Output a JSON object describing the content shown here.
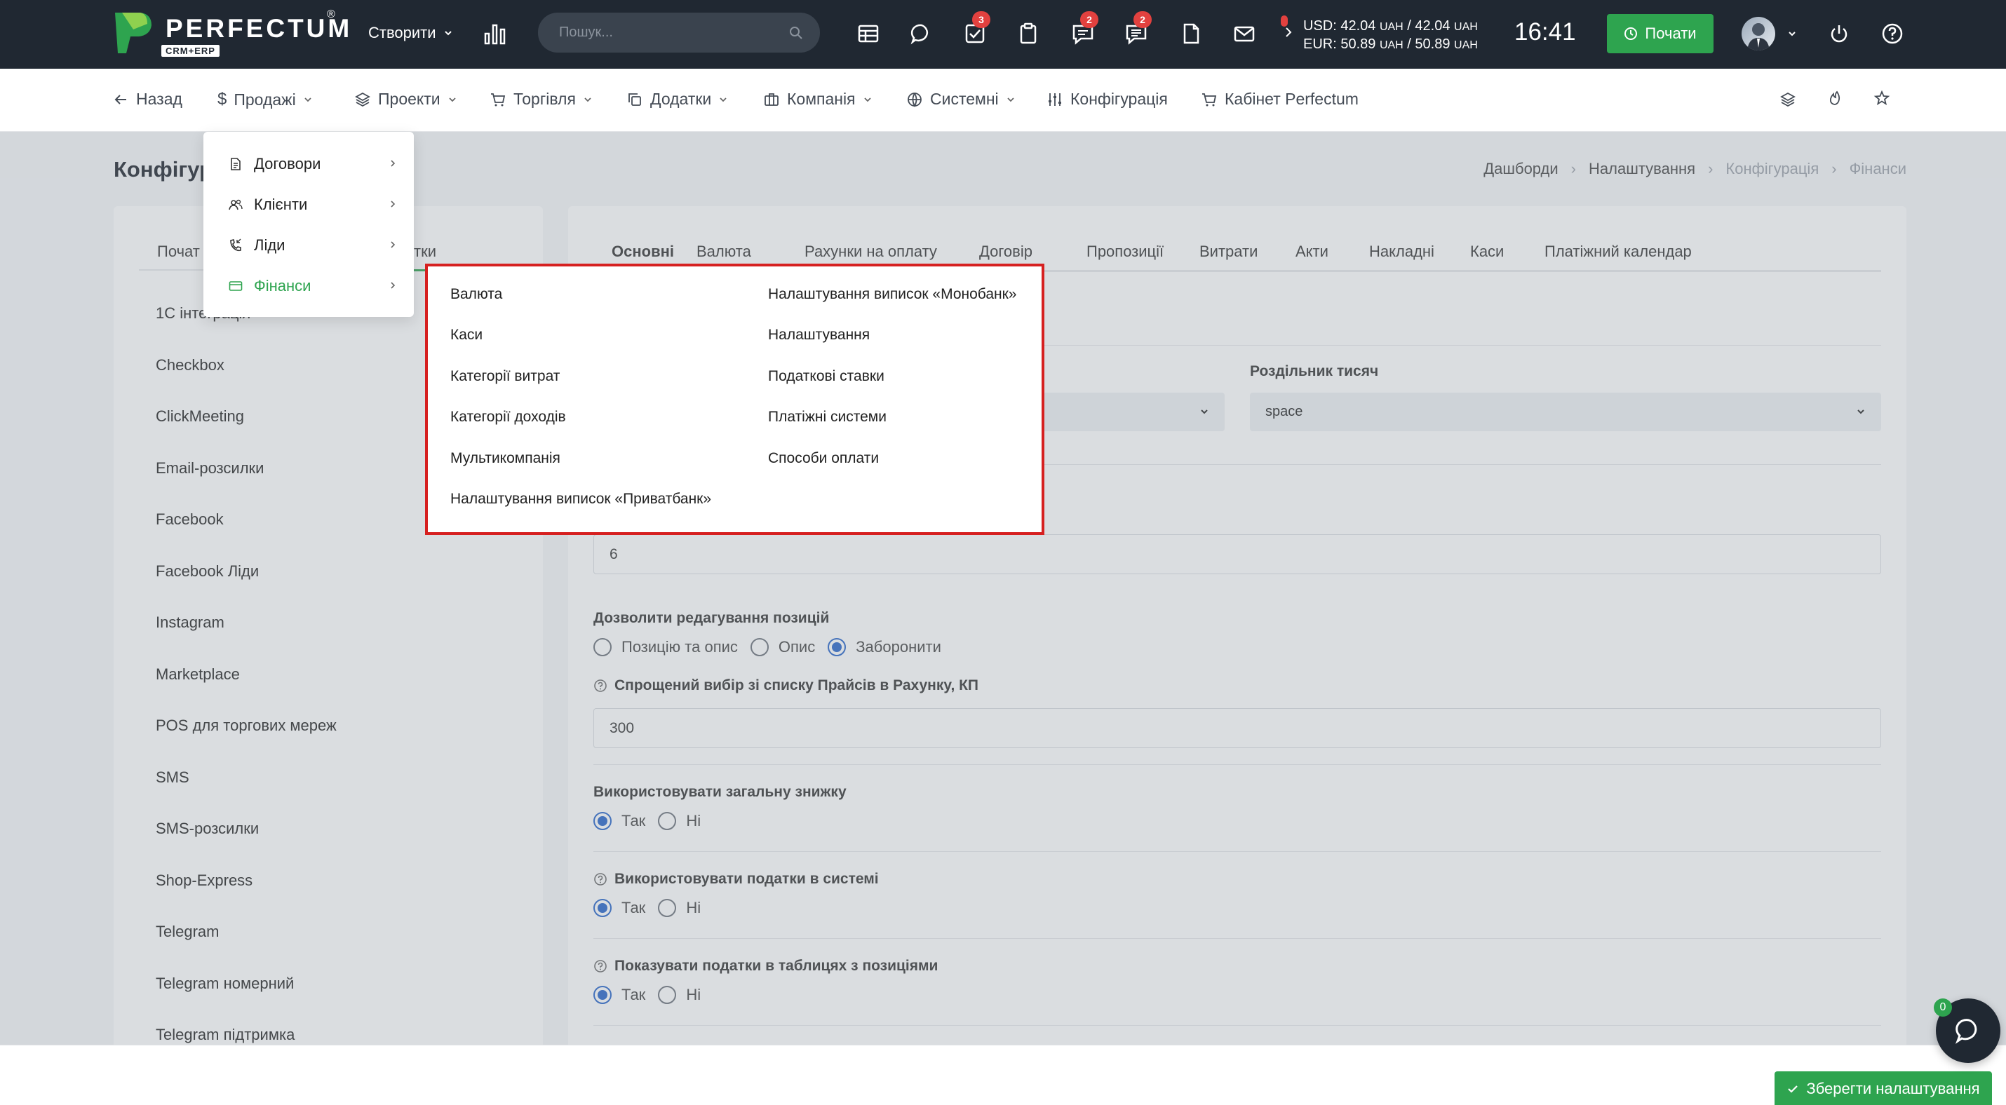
{
  "topbar": {
    "logo_text": "PERFECTUM",
    "logo_sub": "CRM+ERP",
    "logo_reg": "®",
    "create_label": "Створити",
    "search_placeholder": "Пошук...",
    "badges": {
      "tasks": "3",
      "chat": "2",
      "messages": "2"
    },
    "rates": {
      "usd_prefix": "USD: 42.04 ",
      "usd_unit1": "UAH",
      "usd_mid": " / 42.04 ",
      "usd_unit2": "UAH",
      "eur_prefix": "EUR: 50.89 ",
      "eur_unit1": "UAH",
      "eur_mid": " / 50.89 ",
      "eur_unit2": "UAH"
    },
    "clock": "16:41",
    "start_label": "Почати"
  },
  "subnav": {
    "back": "Назад",
    "sales": "Продажі",
    "projects": "Проекти",
    "trade": "Торгівля",
    "addons": "Додатки",
    "company": "Компанія",
    "system": "Системні",
    "config": "Конфігурація",
    "cabinet": "Кабінет Perfectum"
  },
  "page": {
    "title": "Конфігурація",
    "breadcrumb": [
      "Дашборди",
      "Налаштування",
      "Конфігурація",
      "Фінанси"
    ]
  },
  "left": {
    "tabs": [
      "Почат",
      "тки"
    ],
    "items": [
      "1С інтеграція",
      "Checkbox",
      "ClickMeeting",
      "Email-розсилки",
      "Facebook",
      "Facebook Ліди",
      "Instagram",
      "Marketplace",
      "POS для торгових мереж",
      "SMS",
      "SMS-розсилки",
      "Shop-Express",
      "Telegram",
      "Telegram номерний",
      "Telegram підтримка"
    ]
  },
  "right": {
    "tabs": [
      "Основні",
      "Валюта",
      "Рахунки на оплату",
      "Договір",
      "Пропозиції",
      "Витрати",
      "Акти",
      "Накладні",
      "Каси",
      "Платіжний календар"
    ],
    "thousand_sep_label": "Роздільник тисяч",
    "thousand_sep_value": "space",
    "decimals_value": "6",
    "edit_positions_label": "Дозволити редагування позицій",
    "edit_positions_options": [
      "Позицію та опис",
      "Опис",
      "Заборонити"
    ],
    "price_select_label": "Спрощений вибір зі списку Прайсів в Рахунку, КП",
    "price_select_value": "300",
    "global_discount_label": "Використовувати загальну знижку",
    "use_taxes_label": "Використовувати податки в системі",
    "show_taxes_label": "Показувати податки в таблицях з позиціями",
    "yes": "Так",
    "no": "Ні"
  },
  "sales_menu": {
    "items": [
      "Договори",
      "Клієнти",
      "Ліди",
      "Фінанси"
    ]
  },
  "finance_menu": {
    "col1": [
      "Валюта",
      "Каси",
      "Категорії витрат",
      "Категорії доходів",
      "Мультикомпанія",
      "Налаштування виписок «Приватбанк»"
    ],
    "col2": [
      "Налаштування виписок «Монобанк»",
      "Налаштування",
      "Податкові ставки",
      "Платіжні системи",
      "Способи оплати"
    ]
  },
  "footer": {
    "save_label": "Зберегти налаштування",
    "chat_count": "0"
  },
  "colors": {
    "accent_green": "#2ea44f",
    "topbar": "#202832",
    "badge_red": "#e2413f",
    "radio_blue": "#2563c9",
    "highlight_red": "#d62020"
  }
}
